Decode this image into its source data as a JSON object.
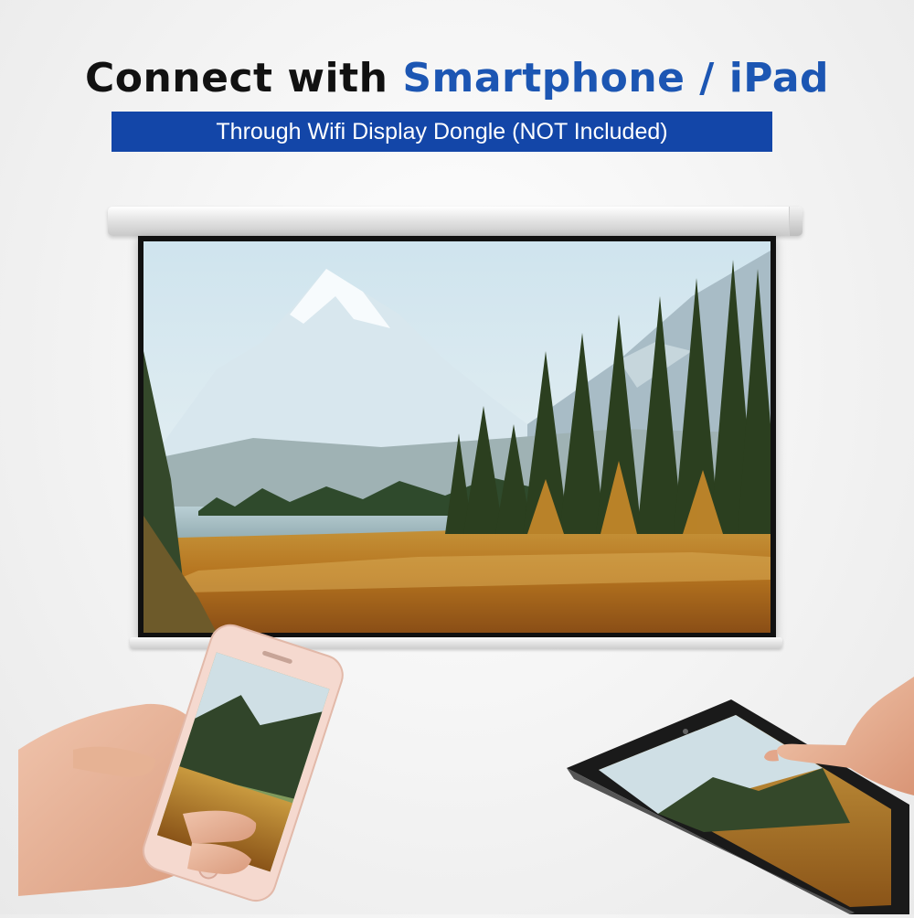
{
  "headline": {
    "part1": "Connect with ",
    "part2": "Smartphone / iPad"
  },
  "banner": {
    "text": "Through Wifi Display Dongle (NOT Included)"
  },
  "colors": {
    "accent": "#1c56b3",
    "banner_bg": "#1346a8",
    "headline_dark": "#111111"
  },
  "icons": {
    "phone": "smartphone-icon",
    "tablet": "tablet-icon"
  }
}
